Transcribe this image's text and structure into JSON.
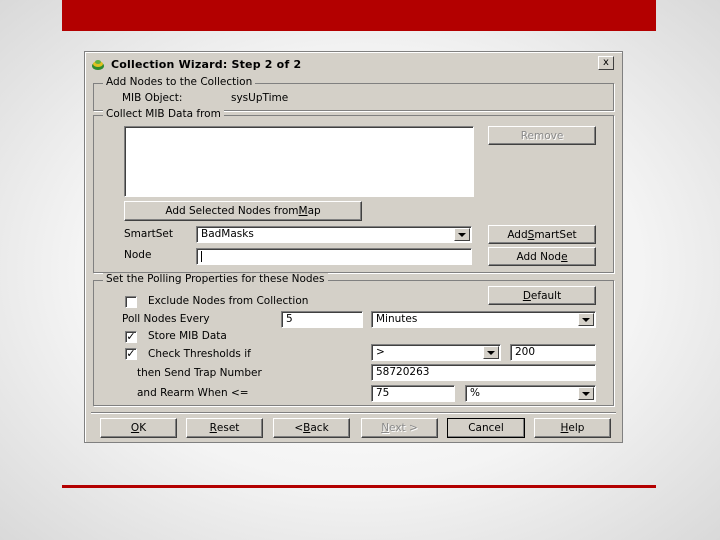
{
  "window": {
    "title": "Collection Wizard: Step 2 of 2",
    "close_glyph": "x"
  },
  "add_nodes_group": {
    "label": "Add Nodes to the Collection",
    "mib_object_label": "MIB Object:",
    "mib_object_value": "sysUpTime"
  },
  "collect_group": {
    "label": "Collect MIB Data from",
    "remove_button": "Remove",
    "add_selected_pre": "Add Selected Nodes from ",
    "add_selected_u": "M",
    "add_selected_post": "ap",
    "smartset_label": "SmartSet",
    "smartset_value": "BadMasks",
    "add_smartset_pre": "Add ",
    "add_smartset_u": "S",
    "add_smartset_post": "martSet",
    "node_label": "Node",
    "node_value": "",
    "add_node_pre": "Add Nod",
    "add_node_u": "e",
    "add_node_post": ""
  },
  "polling_group": {
    "label": "Set the Polling Properties for these Nodes",
    "exclude_label": "Exclude Nodes from Collection",
    "exclude_checked": "",
    "default_button_pre": "",
    "default_button_u": "D",
    "default_button_post": "efault",
    "poll_label": "Poll Nodes Every",
    "poll_value": "5",
    "poll_unit": "Minutes",
    "store_label": "Store MIB Data",
    "store_checked": "✓",
    "check_label": "Check Thresholds  if",
    "check_checked": "✓",
    "operator": ">",
    "threshold": "200",
    "trap_label": "then Send Trap Number",
    "trap_value": "58720263",
    "rearm_label": "and Rearm When  <=",
    "rearm_value": "75",
    "rearm_unit": "%"
  },
  "footer": {
    "ok_pre": "",
    "ok_u": "O",
    "ok_post": "K",
    "reset_pre": "",
    "reset_u": "R",
    "reset_post": "eset",
    "back_pre": "< ",
    "back_u": "B",
    "back_post": "ack",
    "next_pre": "",
    "next_u": "N",
    "next_post": "ext >",
    "cancel_label": "Cancel",
    "help_pre": "",
    "help_u": "H",
    "help_post": "elp"
  },
  "colors": {
    "accent_red": "#b30000",
    "dialog_face": "#d4d0c8"
  }
}
